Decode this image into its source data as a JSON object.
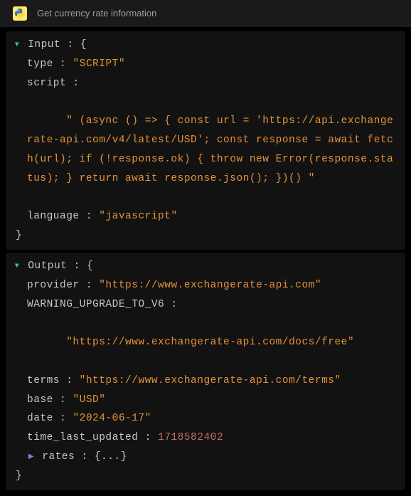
{
  "header": {
    "title": "Get currency rate information"
  },
  "input": {
    "section_label": "Input",
    "open_brace": "{",
    "type_key": "type",
    "type_val": "\"SCRIPT\"",
    "script_key": "script",
    "script_val": "\" (async () => { const url = 'https://api.exchangerate-api.com/v4/latest/USD'; const response = await fetch(url); if (!response.ok) { throw new Error(response.status); } return await response.json(); })() \"",
    "language_key": "language",
    "language_val": "\"javascript\"",
    "close_brace": "}"
  },
  "output": {
    "section_label": "Output",
    "open_brace": "{",
    "provider_key": "provider",
    "provider_val": "\"https://www.exchangerate-api.com\"",
    "warning_key": "WARNING_UPGRADE_TO_V6",
    "warning_val": "\"https://www.exchangerate-api.com/docs/free\"",
    "terms_key": "terms",
    "terms_val": "\"https://www.exchangerate-api.com/terms\"",
    "base_key": "base",
    "base_val": "\"USD\"",
    "date_key": "date",
    "date_val": "\"2024-06-17\"",
    "time_key": "time_last_updated",
    "time_val": "1718582402",
    "rates_key": "rates",
    "rates_open": "{",
    "rates_dots": "...",
    "rates_close": "}",
    "close_brace": "}"
  },
  "punct": {
    "colon": " : "
  }
}
